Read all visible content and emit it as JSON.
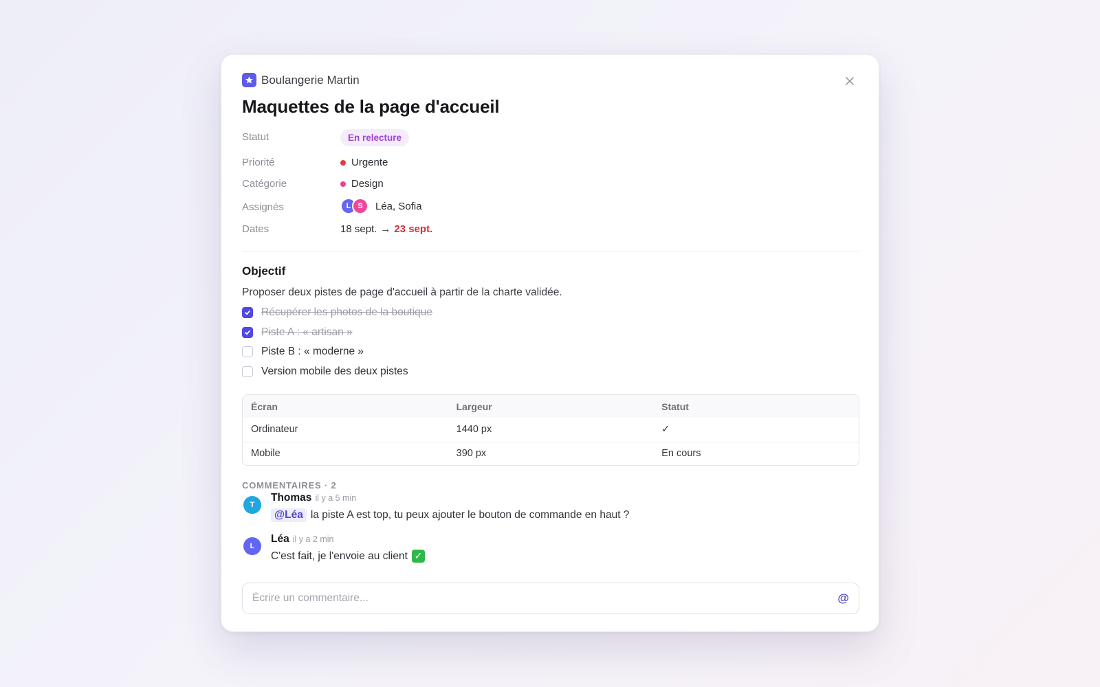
{
  "project": {
    "name": "Boulangerie Martin",
    "icon": "star-icon",
    "accent": "#5e5ce6"
  },
  "task": {
    "title": "Maquettes de la page d'accueil"
  },
  "properties": {
    "status": {
      "label": "Statut",
      "value": "En relecture",
      "color": "#a043d4"
    },
    "priority": {
      "label": "Priorité",
      "value": "Urgente",
      "color": "#e53945"
    },
    "category": {
      "label": "Catégorie",
      "value": "Design",
      "color": "#e8458f"
    },
    "assignees": {
      "label": "Assignés",
      "value": "Léa, Sofia",
      "avatars": [
        {
          "initial": "L",
          "color": "#6366f1"
        },
        {
          "initial": "S",
          "color": "#ec4899"
        }
      ]
    },
    "dates": {
      "label": "Dates",
      "start": "18 sept.",
      "arrow": "→",
      "end": "23 sept.",
      "end_color": "#d12d3f"
    }
  },
  "objective": {
    "title": "Objectif",
    "description": "Proposer deux pistes de page d'accueil à partir de la charte validée.",
    "checklist": [
      {
        "label": "Récupérer les photos de la boutique",
        "checked": true
      },
      {
        "label": "Piste A : « artisan »",
        "checked": true
      },
      {
        "label": "Piste B : « moderne »",
        "checked": false
      },
      {
        "label": "Version mobile des deux pistes",
        "checked": false
      }
    ]
  },
  "table": {
    "headers": [
      "Écran",
      "Largeur",
      "Statut"
    ],
    "rows": [
      [
        "Ordinateur",
        "1440 px",
        "✓"
      ],
      [
        "Mobile",
        "390 px",
        "En cours"
      ]
    ]
  },
  "comments": {
    "title": "COMMENTAIRES · 2",
    "items": [
      {
        "author": "Thomas",
        "initial": "T",
        "color": "#1ea7e0",
        "time": "il y a 5 min",
        "mention": "@Léa",
        "text": "la piste A est top, tu peux ajouter le bouton de commande en haut ?"
      },
      {
        "author": "Léa",
        "initial": "L",
        "color": "#6366f1",
        "time": "il y a 2 min",
        "text": "C'est fait, je l'envoie au client",
        "emoji": "✅"
      }
    ],
    "input_placeholder": "Écrire un commentaire...",
    "mention_button": "@"
  }
}
